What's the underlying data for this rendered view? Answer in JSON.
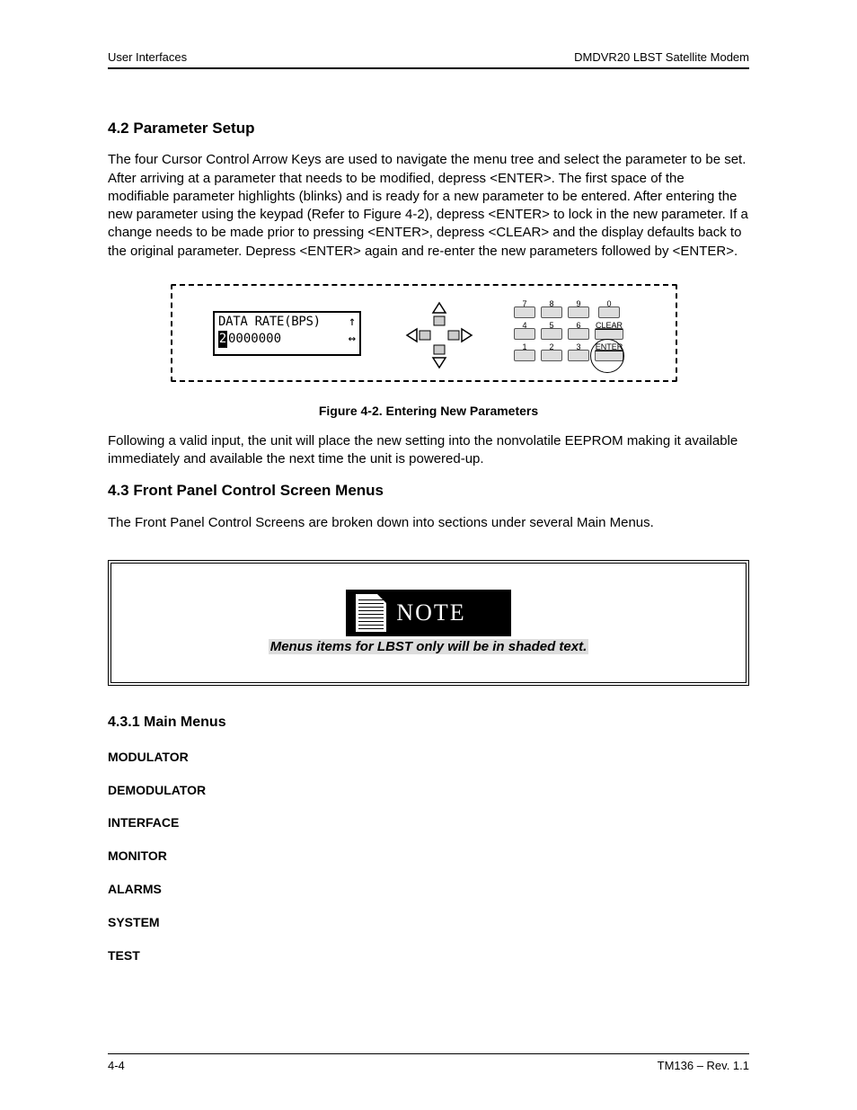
{
  "header": {
    "left": "User Interfaces",
    "right": "DMDVR20 LBST Satellite Modem"
  },
  "section_4_2": {
    "title": "4.2  Parameter Setup",
    "paragraph": "The four Cursor Control Arrow Keys are used to navigate the menu tree and select the parameter to be set.  After arriving at a parameter that needs to be modified, depress  <ENTER>.  The first space of the modifiable parameter highlights (blinks) and is ready for a new parameter to be entered.  After entering the new parameter using the keypad (Refer to Figure 4-2), depress <ENTER> to lock in the new parameter.  If a change needs to be made prior to pressing <ENTER>, depress <CLEAR> and the display defaults back to the original parameter.  Depress <ENTER> again and re-enter the new parameters followed by  <ENTER>."
  },
  "figure": {
    "lcd_line1_label": "DATA RATE(BPS)",
    "lcd_line1_arrow": "↑",
    "lcd_cursor_digit": "2",
    "lcd_line2_digits": "0000000",
    "lcd_line2_arrow": "↔",
    "caption": "Figure 4-2.  Entering New Parameters",
    "keypad": {
      "r1": [
        "7",
        "8",
        "9",
        "0"
      ],
      "r2": [
        "4",
        "5",
        "6",
        "CLEAR"
      ],
      "r3": [
        "1",
        "2",
        "3",
        "ENTER"
      ]
    }
  },
  "after_figure_paragraph": "Following a valid input, the unit will place the new setting into the nonvolatile EEPROM making it available immediately and available the next time the unit is powered-up.",
  "section_4_3": {
    "title": "4.3  Front Panel Control Screen Menus",
    "paragraph": "The Front Panel Control Screens are broken down into sections under several Main Menus."
  },
  "note": {
    "banner": "NOTE",
    "text": "Menus items for LBST only will be in shaded text."
  },
  "section_4_3_1": {
    "title": "4.3.1  Main Menus",
    "menus": [
      "MODULATOR",
      "DEMODULATOR",
      "INTERFACE",
      "MONITOR",
      "ALARMS",
      "SYSTEM",
      "TEST"
    ]
  },
  "footer": {
    "left": "4-4",
    "right": "TM136 – Rev. 1.1"
  }
}
